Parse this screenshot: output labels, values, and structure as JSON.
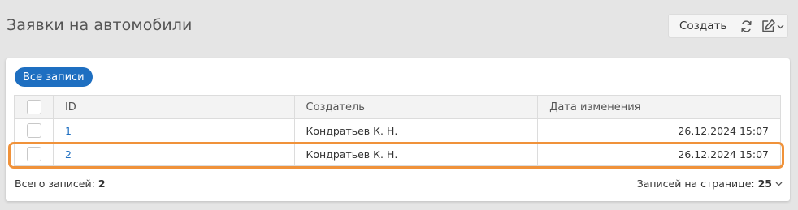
{
  "header": {
    "title": "Заявки на автомобили",
    "create_label": "Создать"
  },
  "filter": {
    "label": "Все записи"
  },
  "table": {
    "columns": [
      "ID",
      "Создатель",
      "Дата изменения"
    ],
    "rows": [
      {
        "id": "1",
        "creator": "Кондратьев К. Н.",
        "modified": "26.12.2024 15:07"
      },
      {
        "id": "2",
        "creator": "Кондратьев К. Н.",
        "modified": "26.12.2024 15:07"
      }
    ]
  },
  "footer": {
    "total_label": "Всего записей:",
    "total_value": "2",
    "page_size_label": "Записей на странице:",
    "page_size_value": "25"
  },
  "colors": {
    "accent": "#1e6fc1",
    "highlight": "#f0923a"
  },
  "icons": [
    "refresh-icon",
    "edit-icon",
    "chevron-down-icon"
  ]
}
